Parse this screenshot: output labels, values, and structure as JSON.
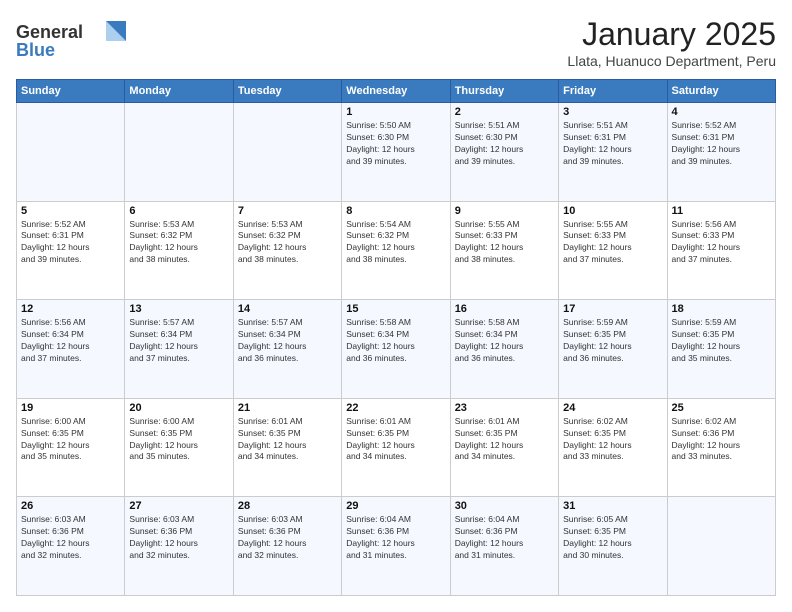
{
  "logo": {
    "general": "General",
    "blue": "Blue"
  },
  "header": {
    "month_title": "January 2025",
    "location": "Llata, Huanuco Department, Peru"
  },
  "weekdays": [
    "Sunday",
    "Monday",
    "Tuesday",
    "Wednesday",
    "Thursday",
    "Friday",
    "Saturday"
  ],
  "weeks": [
    [
      {
        "day": "",
        "info": ""
      },
      {
        "day": "",
        "info": ""
      },
      {
        "day": "",
        "info": ""
      },
      {
        "day": "1",
        "info": "Sunrise: 5:50 AM\nSunset: 6:30 PM\nDaylight: 12 hours\nand 39 minutes."
      },
      {
        "day": "2",
        "info": "Sunrise: 5:51 AM\nSunset: 6:30 PM\nDaylight: 12 hours\nand 39 minutes."
      },
      {
        "day": "3",
        "info": "Sunrise: 5:51 AM\nSunset: 6:31 PM\nDaylight: 12 hours\nand 39 minutes."
      },
      {
        "day": "4",
        "info": "Sunrise: 5:52 AM\nSunset: 6:31 PM\nDaylight: 12 hours\nand 39 minutes."
      }
    ],
    [
      {
        "day": "5",
        "info": "Sunrise: 5:52 AM\nSunset: 6:31 PM\nDaylight: 12 hours\nand 39 minutes."
      },
      {
        "day": "6",
        "info": "Sunrise: 5:53 AM\nSunset: 6:32 PM\nDaylight: 12 hours\nand 38 minutes."
      },
      {
        "day": "7",
        "info": "Sunrise: 5:53 AM\nSunset: 6:32 PM\nDaylight: 12 hours\nand 38 minutes."
      },
      {
        "day": "8",
        "info": "Sunrise: 5:54 AM\nSunset: 6:32 PM\nDaylight: 12 hours\nand 38 minutes."
      },
      {
        "day": "9",
        "info": "Sunrise: 5:55 AM\nSunset: 6:33 PM\nDaylight: 12 hours\nand 38 minutes."
      },
      {
        "day": "10",
        "info": "Sunrise: 5:55 AM\nSunset: 6:33 PM\nDaylight: 12 hours\nand 37 minutes."
      },
      {
        "day": "11",
        "info": "Sunrise: 5:56 AM\nSunset: 6:33 PM\nDaylight: 12 hours\nand 37 minutes."
      }
    ],
    [
      {
        "day": "12",
        "info": "Sunrise: 5:56 AM\nSunset: 6:34 PM\nDaylight: 12 hours\nand 37 minutes."
      },
      {
        "day": "13",
        "info": "Sunrise: 5:57 AM\nSunset: 6:34 PM\nDaylight: 12 hours\nand 37 minutes."
      },
      {
        "day": "14",
        "info": "Sunrise: 5:57 AM\nSunset: 6:34 PM\nDaylight: 12 hours\nand 36 minutes."
      },
      {
        "day": "15",
        "info": "Sunrise: 5:58 AM\nSunset: 6:34 PM\nDaylight: 12 hours\nand 36 minutes."
      },
      {
        "day": "16",
        "info": "Sunrise: 5:58 AM\nSunset: 6:34 PM\nDaylight: 12 hours\nand 36 minutes."
      },
      {
        "day": "17",
        "info": "Sunrise: 5:59 AM\nSunset: 6:35 PM\nDaylight: 12 hours\nand 36 minutes."
      },
      {
        "day": "18",
        "info": "Sunrise: 5:59 AM\nSunset: 6:35 PM\nDaylight: 12 hours\nand 35 minutes."
      }
    ],
    [
      {
        "day": "19",
        "info": "Sunrise: 6:00 AM\nSunset: 6:35 PM\nDaylight: 12 hours\nand 35 minutes."
      },
      {
        "day": "20",
        "info": "Sunrise: 6:00 AM\nSunset: 6:35 PM\nDaylight: 12 hours\nand 35 minutes."
      },
      {
        "day": "21",
        "info": "Sunrise: 6:01 AM\nSunset: 6:35 PM\nDaylight: 12 hours\nand 34 minutes."
      },
      {
        "day": "22",
        "info": "Sunrise: 6:01 AM\nSunset: 6:35 PM\nDaylight: 12 hours\nand 34 minutes."
      },
      {
        "day": "23",
        "info": "Sunrise: 6:01 AM\nSunset: 6:35 PM\nDaylight: 12 hours\nand 34 minutes."
      },
      {
        "day": "24",
        "info": "Sunrise: 6:02 AM\nSunset: 6:35 PM\nDaylight: 12 hours\nand 33 minutes."
      },
      {
        "day": "25",
        "info": "Sunrise: 6:02 AM\nSunset: 6:36 PM\nDaylight: 12 hours\nand 33 minutes."
      }
    ],
    [
      {
        "day": "26",
        "info": "Sunrise: 6:03 AM\nSunset: 6:36 PM\nDaylight: 12 hours\nand 32 minutes."
      },
      {
        "day": "27",
        "info": "Sunrise: 6:03 AM\nSunset: 6:36 PM\nDaylight: 12 hours\nand 32 minutes."
      },
      {
        "day": "28",
        "info": "Sunrise: 6:03 AM\nSunset: 6:36 PM\nDaylight: 12 hours\nand 32 minutes."
      },
      {
        "day": "29",
        "info": "Sunrise: 6:04 AM\nSunset: 6:36 PM\nDaylight: 12 hours\nand 31 minutes."
      },
      {
        "day": "30",
        "info": "Sunrise: 6:04 AM\nSunset: 6:36 PM\nDaylight: 12 hours\nand 31 minutes."
      },
      {
        "day": "31",
        "info": "Sunrise: 6:05 AM\nSunset: 6:35 PM\nDaylight: 12 hours\nand 30 minutes."
      },
      {
        "day": "",
        "info": ""
      }
    ]
  ]
}
